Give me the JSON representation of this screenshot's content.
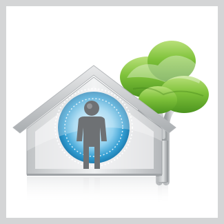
{
  "illustration": {
    "subject": "house-with-person-and-tree",
    "icons": [
      "house-icon",
      "person-icon",
      "tree-icon"
    ],
    "colors": {
      "frame": "#d4d5d6",
      "background": "#ffffff",
      "house_silver": "#c6c8ca",
      "house_dark": "#8f9396",
      "glow_blue": "#3aa3d6",
      "person_gray": "#6e7174",
      "tree_green": "#7bbf2a",
      "tree_dark": "#4f9a1e"
    }
  }
}
